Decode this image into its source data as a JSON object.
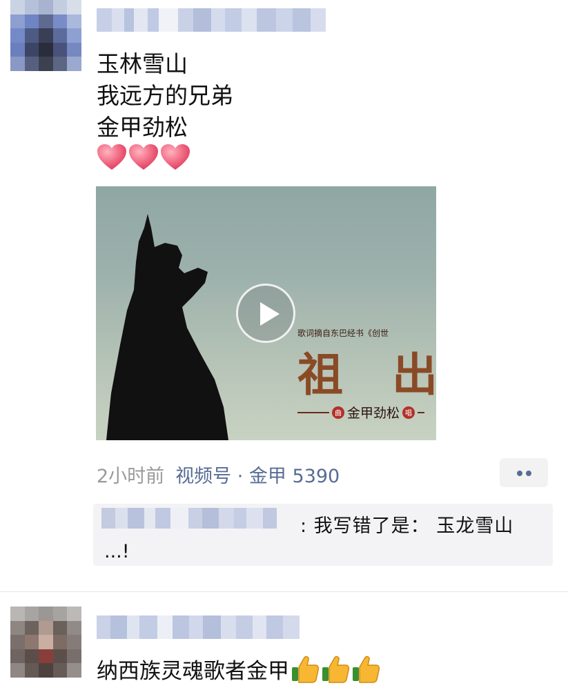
{
  "post1": {
    "avatar_icon": "pixelated-avatar-icon",
    "lines": [
      "玉林雪山",
      "我远方的兄弟",
      "金甲劲松"
    ],
    "emoji_hearts": 3,
    "video": {
      "caption_small": "歌词摘自东巴经书《创世",
      "title_char": "祖 出",
      "credit": "金甲劲松",
      "seal_left": "曲",
      "seal_right": "唱"
    },
    "time": "2小时前",
    "source": "视频号 · 金甲 5390",
    "more_icon": "more-dots-icon"
  },
  "comment": {
    "text_line1": ": 我写错了是： 玉龙雪山",
    "text_line2": "...!"
  },
  "post2": {
    "text": "纳西族灵魂歌者金甲",
    "emoji_thumbs": 3
  },
  "colors": {
    "link": "#576b95",
    "meta": "#9a9a9a",
    "comment_bg": "#f3f3f5"
  }
}
